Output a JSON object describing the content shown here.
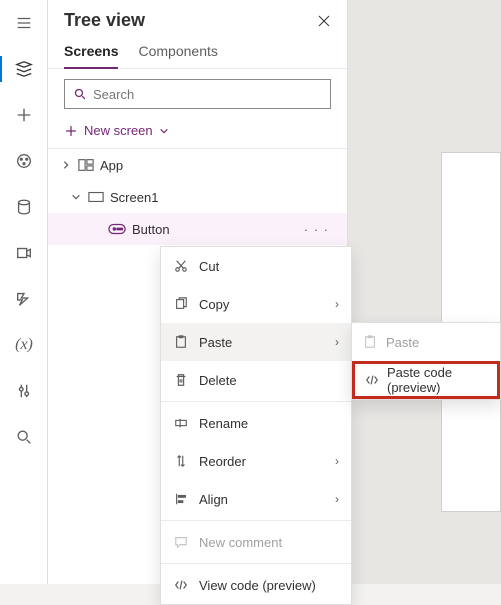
{
  "panel": {
    "title": "Tree view",
    "tabs": {
      "screens": "Screens",
      "components": "Components"
    },
    "search_placeholder": "Search",
    "new_screen": "New screen"
  },
  "tree": {
    "app": "App",
    "screen1": "Screen1",
    "button": "Button"
  },
  "menu": {
    "cut": "Cut",
    "copy": "Copy",
    "paste": "Paste",
    "delete": "Delete",
    "rename": "Rename",
    "reorder": "Reorder",
    "align": "Align",
    "new_comment": "New comment",
    "view_code": "View code (preview)"
  },
  "submenu": {
    "paste": "Paste",
    "paste_code": "Paste code (preview)"
  }
}
